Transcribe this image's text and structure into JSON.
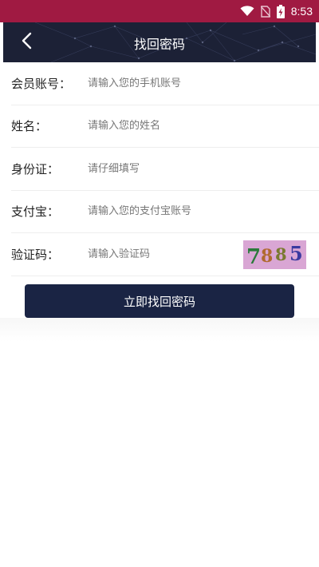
{
  "status_bar": {
    "time": "8:53",
    "icons": [
      "wifi-icon",
      "no-sim-icon",
      "battery-charging-icon"
    ],
    "color": "#a01a42"
  },
  "header": {
    "title": "找回密码",
    "back_icon": "chevron-left-icon",
    "color": "#1c2136"
  },
  "form": {
    "fields": [
      {
        "label": "会员账号：",
        "placeholder": "请输入您的手机账号"
      },
      {
        "label": "姓名：",
        "placeholder": "请输入您的姓名"
      },
      {
        "label": "身份证：",
        "placeholder": "请仔细填写"
      },
      {
        "label": "支付宝：",
        "placeholder": "请输入您的支付宝账号"
      },
      {
        "label": "验证码：",
        "placeholder": "请输入验证码"
      }
    ],
    "captcha": {
      "digits": [
        "7",
        "8",
        "8",
        "5"
      ],
      "digit_colors": [
        "#2a7a3a",
        "#b06a30",
        "#7a7a30",
        "#3a3aa0"
      ],
      "background": "#d9a6d4"
    }
  },
  "submit": {
    "label": "立即找回密码",
    "color": "#1a2444"
  }
}
